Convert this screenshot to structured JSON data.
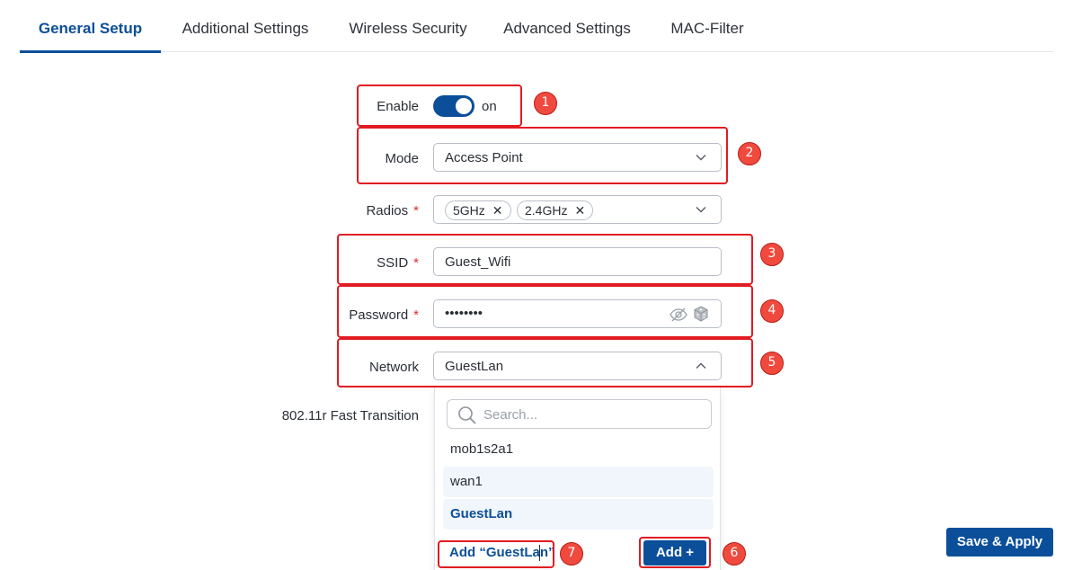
{
  "tabs": [
    {
      "label": "General Setup",
      "active": true
    },
    {
      "label": "Additional Settings"
    },
    {
      "label": "Wireless Security"
    },
    {
      "label": "Advanced Settings"
    },
    {
      "label": "MAC-Filter"
    }
  ],
  "form": {
    "enable": {
      "label": "Enable",
      "state": "on"
    },
    "mode": {
      "label": "Mode",
      "value": "Access Point"
    },
    "radios": {
      "label": "Radios",
      "required": "*",
      "chips": [
        "5GHz",
        "2.4GHz"
      ],
      "remove_glyph": "✕"
    },
    "ssid": {
      "label": "SSID",
      "required": "*",
      "value": "Guest_Wifi"
    },
    "password": {
      "label": "Password",
      "required": "*",
      "value": "••••••••"
    },
    "network": {
      "label": "Network",
      "value": "GuestLan"
    },
    "fast_transition": {
      "label": "802.11r Fast Transition"
    }
  },
  "dropdown": {
    "search_placeholder": "Search...",
    "options": [
      "mob1s2a1",
      "wan1",
      "GuestLan"
    ],
    "add_link": "Add “GuestLan”",
    "add_button": "Add +"
  },
  "annotations": [
    "1",
    "2",
    "3",
    "4",
    "5",
    "6",
    "7"
  ],
  "footer": {
    "save_apply": "Save & Apply"
  },
  "colors": {
    "accent": "#0b4f9a",
    "annotation": "#e11b22",
    "badge": "#f04a3e",
    "required": "#e0262a"
  },
  "icons": [
    "chevron-down-icon",
    "chevron-up-icon",
    "close-icon",
    "eye-off-icon",
    "dice-icon",
    "search-icon"
  ]
}
